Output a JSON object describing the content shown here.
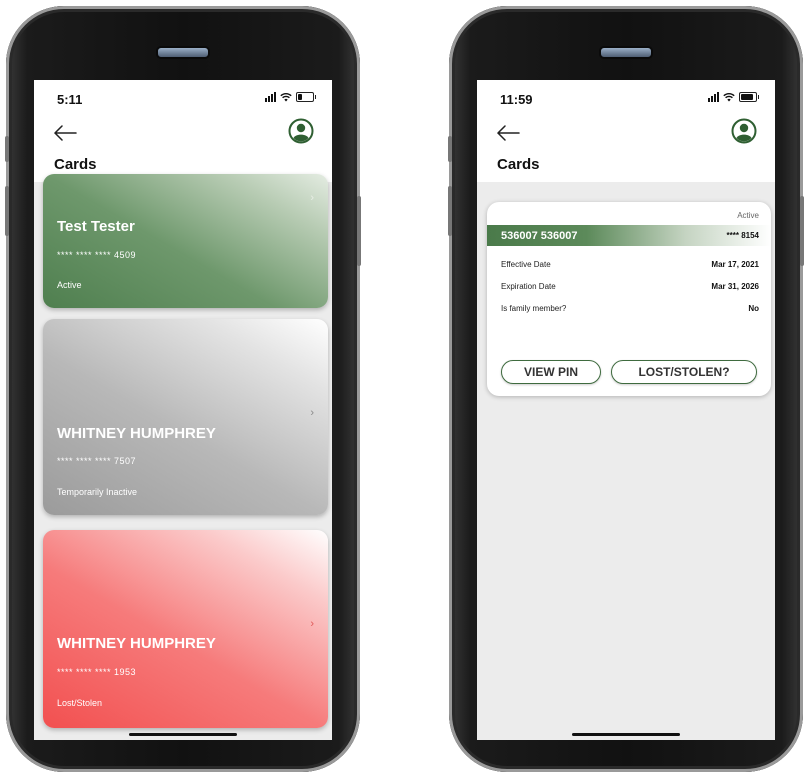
{
  "left_screen": {
    "status_bar": {
      "time": "5:11"
    },
    "header": {
      "title": "Cards"
    },
    "cards": [
      {
        "name": "Test Tester",
        "masked_number": "**** **** **** 4509",
        "status": "Active",
        "chevron": "›"
      },
      {
        "name": "WHITNEY HUMPHREY",
        "masked_number": "**** **** **** 7507",
        "status": "Temporarily Inactive",
        "chevron": "›"
      },
      {
        "name": "WHITNEY HUMPHREY",
        "masked_number": "**** **** **** 1953",
        "status": "Lost/Stolen",
        "chevron": "›"
      }
    ]
  },
  "right_screen": {
    "status_bar": {
      "time": "11:59"
    },
    "header": {
      "title": "Cards"
    },
    "card": {
      "status": "Active",
      "number": "536007 536007",
      "last4": "**** 8154",
      "rows": [
        {
          "label": "Effective Date",
          "value": "Mar 17, 2021"
        },
        {
          "label": "Expiration Date",
          "value": "Mar 31, 2026"
        },
        {
          "label": "Is family member?",
          "value": "No"
        }
      ],
      "view_pin_label": "VIEW PIN",
      "lost_stolen_label": "LOST/STOLEN?"
    }
  },
  "colors": {
    "brand_green": "#4f7f4f",
    "inactive_gray": "#9b9b9b",
    "lost_red": "#f25050"
  },
  "icons": [
    "back-arrow-icon",
    "account-avatar-icon",
    "cellular-signal-icon",
    "wifi-icon",
    "battery-icon",
    "chevron-right-icon"
  ]
}
